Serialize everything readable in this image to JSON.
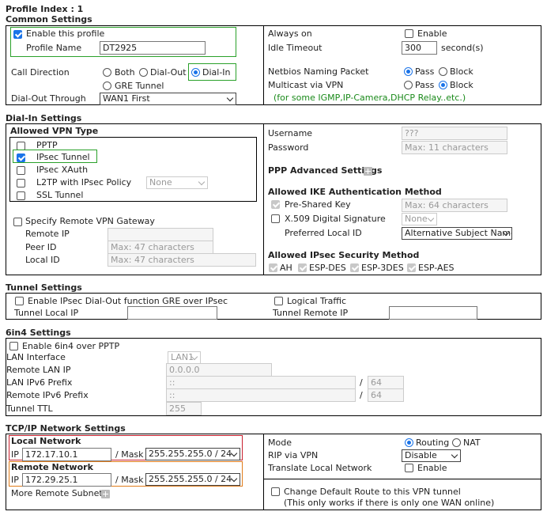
{
  "profile_index": "Profile Index : 1",
  "common": {
    "title": "Common Settings",
    "enable_profile": "Enable this profile",
    "profile_name_label": "Profile Name",
    "profile_name_value": "DT2925",
    "call_direction_label": "Call Direction",
    "dir_both": "Both",
    "dir_dialout": "Dial-Out",
    "dir_dialin": "Dial-In",
    "dir_gre": "GRE Tunnel",
    "dialout_through_label": "Dial-Out Through",
    "dialout_through_value": "WAN1 First",
    "always_on_label": "Always on",
    "always_on_enable": "Enable",
    "idle_timeout_label": "Idle Timeout",
    "idle_timeout_value": "300",
    "idle_timeout_unit": "second(s)",
    "netbios_label": "Netbios Naming Packet",
    "netbios_pass": "Pass",
    "netbios_block": "Block",
    "multicast_label": "Multicast via VPN",
    "multicast_pass": "Pass",
    "multicast_block": "Block",
    "multicast_note": "(for some IGMP,IP-Camera,DHCP Relay..etc.)"
  },
  "dialin": {
    "title": "Dial-In Settings",
    "allowed_vpn_type": "Allowed VPN Type",
    "types": [
      {
        "label": "PPTP",
        "checked": false
      },
      {
        "label": "IPsec Tunnel",
        "checked": true
      },
      {
        "label": "IPsec XAuth",
        "checked": false
      },
      {
        "label": "L2TP with IPsec Policy",
        "checked": false
      },
      {
        "label": "SSL Tunnel",
        "checked": false
      }
    ],
    "l2tp_policy_value": "None",
    "specify_gateway": "Specify Remote VPN Gateway",
    "remote_ip_label": "Remote IP",
    "peer_id_label": "Peer ID",
    "peer_id_placeholder": "Max: 47 characters",
    "local_id_label": "Local ID",
    "local_id_placeholder": "Max: 47 characters",
    "username_label": "Username",
    "username_value": "???",
    "password_label": "Password",
    "password_placeholder": "Max: 11 characters",
    "ppp_advanced": "PPP Advanced Settings",
    "ike_title": "Allowed IKE Authentication Method",
    "psk_label": "Pre-Shared Key",
    "psk_placeholder": "Max: 64 characters",
    "x509_label": "X.509 Digital Signature",
    "x509_value": "None",
    "preferred_local_id_label": "Preferred Local ID",
    "preferred_local_id_value": "Alternative Subject Name",
    "ipsec_sec_title": "Allowed IPsec Security Method",
    "sec_methods": [
      "AH",
      "ESP-DES",
      "ESP-3DES",
      "ESP-AES"
    ]
  },
  "tunnel": {
    "title": "Tunnel Settings",
    "gre_label": "Enable IPsec Dial-Out function GRE over IPsec",
    "logical_traffic": "Logical Traffic",
    "local_ip_label": "Tunnel Local IP",
    "remote_ip_label": "Tunnel Remote IP"
  },
  "sixin4": {
    "title": "6in4 Settings",
    "enable_label": "Enable 6in4 over PPTP",
    "lan_interface_label": "LAN Interface",
    "lan_interface_value": "LAN1",
    "remote_lan_ip_label": "Remote LAN IP",
    "remote_lan_ip_value": "0.0.0.0",
    "lan_ipv6_prefix_label": "LAN IPv6 Prefix",
    "lan_ipv6_prefix_value": "::",
    "lan_ipv6_len": "64",
    "remote_ipv6_prefix_label": "Remote IPv6 Prefix",
    "remote_ipv6_prefix_value": "::",
    "remote_ipv6_len": "64",
    "tunnel_ttl_label": "Tunnel TTL",
    "tunnel_ttl_value": "255",
    "slash": "/"
  },
  "tcpip": {
    "title": "TCP/IP Network Settings",
    "local_network": "Local Network",
    "ip_label": "IP",
    "local_ip": "172.17.10.1",
    "mask_label": "/ Mask",
    "local_mask": "255.255.255.0 / 24",
    "remote_network": "Remote Network",
    "remote_ip": "172.29.25.1",
    "remote_mask": "255.255.255.0 / 24",
    "more_subnet": "More Remote Subnet",
    "mode_label": "Mode",
    "mode_routing": "Routing",
    "mode_nat": "NAT",
    "rip_label": "RIP via VPN",
    "rip_value": "Disable",
    "translate_label": "Translate Local Network",
    "translate_enable": "Enable",
    "change_route_label": "Change Default Route to this VPN tunnel",
    "change_route_note": "(This only works if there is only one WAN online)"
  }
}
